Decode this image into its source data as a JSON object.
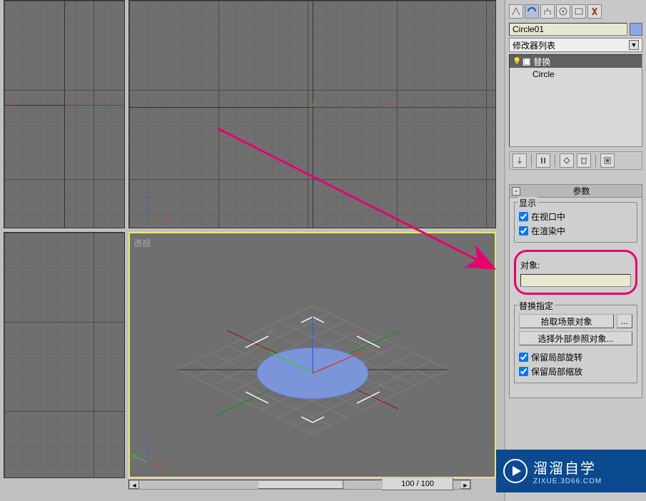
{
  "object_name": "Circle01",
  "modifier_combo": "修改器列表",
  "stack": {
    "item1": "替换",
    "item2": "Circle"
  },
  "viewport_br_label": "透视",
  "time": {
    "label": "100 / 100"
  },
  "rollout": {
    "title": "参数",
    "display_group": "显示",
    "chk_viewport": "在视口中",
    "chk_render": "在渲染中",
    "object_group": "对象:",
    "assign_group": "替换指定",
    "btn_pick": "拾取场景对象",
    "btn_extern": "选择外部参照对象...",
    "chk_keep_rot": "保留局部旋转",
    "chk_keep_scale": "保留局部缩放"
  },
  "axis": {
    "x": "x",
    "y": "y",
    "z": "z"
  },
  "watermark": {
    "title": "溜溜自学",
    "url": "ZIXUE.3D66.COM"
  }
}
